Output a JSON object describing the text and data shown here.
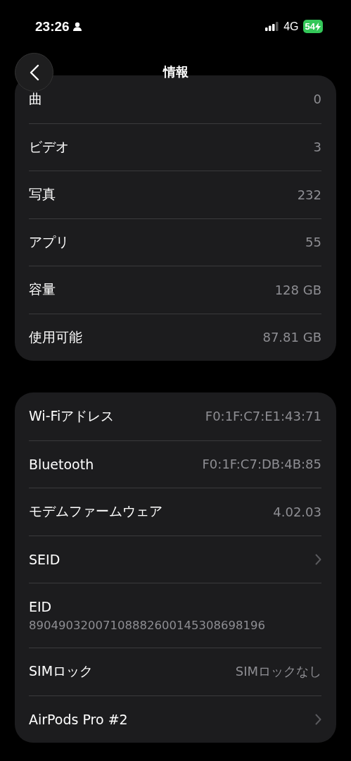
{
  "status_bar": {
    "time": "23:26",
    "network": "4G",
    "battery": "54"
  },
  "nav": {
    "title": "情報"
  },
  "sections": [
    {
      "rows": [
        {
          "kind": "value",
          "label": "曲",
          "value": "0"
        },
        {
          "kind": "value",
          "label": "ビデオ",
          "value": "3"
        },
        {
          "kind": "value",
          "label": "写真",
          "value": "232"
        },
        {
          "kind": "value",
          "label": "アプリ",
          "value": "55"
        },
        {
          "kind": "value",
          "label": "容量",
          "value": "128 GB"
        },
        {
          "kind": "value",
          "label": "使用可能",
          "value": "87.81 GB"
        }
      ]
    },
    {
      "rows": [
        {
          "kind": "value",
          "label": "Wi-Fiアドレス",
          "value": "F0:1F:C7:E1:43:71"
        },
        {
          "kind": "value",
          "label": "Bluetooth",
          "value": "F0:1F:C7:DB:4B:85"
        },
        {
          "kind": "value",
          "label": "モデムファームウェア",
          "value": "4.02.03"
        },
        {
          "kind": "link",
          "label": "SEID"
        },
        {
          "kind": "stacked",
          "label": "EID",
          "value": "89049032007108882600145308698196"
        },
        {
          "kind": "value",
          "label": "SIMロック",
          "value": "SIMロックなし"
        },
        {
          "kind": "link",
          "label": "AirPods Pro #2"
        }
      ]
    }
  ]
}
